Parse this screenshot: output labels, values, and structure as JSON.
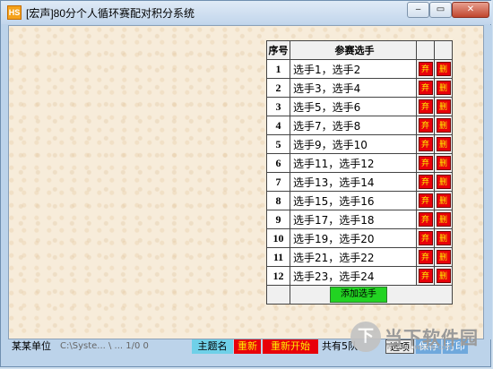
{
  "window": {
    "icon_text": "HS",
    "title": "[宏声]80分个人循环赛配对积分系统",
    "min_symbol": "‒",
    "max_symbol": "▭",
    "close_symbol": "✕"
  },
  "table": {
    "header": {
      "num": "序号",
      "players": "参赛选手"
    },
    "rows": [
      {
        "num": "1",
        "players": "选手1，选手2",
        "forfeit": "弃",
        "delete": "删"
      },
      {
        "num": "2",
        "players": "选手3，选手4",
        "forfeit": "弃",
        "delete": "删"
      },
      {
        "num": "3",
        "players": "选手5，选手6",
        "forfeit": "弃",
        "delete": "删"
      },
      {
        "num": "4",
        "players": "选手7，选手8",
        "forfeit": "弃",
        "delete": "删"
      },
      {
        "num": "5",
        "players": "选手9，选手10",
        "forfeit": "弃",
        "delete": "删"
      },
      {
        "num": "6",
        "players": "选手11，选手12",
        "forfeit": "弃",
        "delete": "删"
      },
      {
        "num": "7",
        "players": "选手13，选手14",
        "forfeit": "弃",
        "delete": "删"
      },
      {
        "num": "8",
        "players": "选手15，选手16",
        "forfeit": "弃",
        "delete": "删"
      },
      {
        "num": "9",
        "players": "选手17，选手18",
        "forfeit": "弃",
        "delete": "删"
      },
      {
        "num": "10",
        "players": "选手19，选手20",
        "forfeit": "弃",
        "delete": "删"
      },
      {
        "num": "11",
        "players": "选手21，选手22",
        "forfeit": "弃",
        "delete": "删"
      },
      {
        "num": "12",
        "players": "选手23，选手24",
        "forfeit": "弃",
        "delete": "删"
      }
    ],
    "add_button": "添加选手"
  },
  "status": {
    "unit": "某某单位",
    "path": "C:\\Syste... \\ ... 1/0 0",
    "topic": "主题名",
    "restart": "重新",
    "begin": "重新开始",
    "count": "共有5队",
    "btn1": "选项",
    "btn2": "保存",
    "btn3": "打印"
  },
  "watermark": {
    "logo": "下",
    "text": "当下软件园",
    "url": "www.downxia.com"
  }
}
